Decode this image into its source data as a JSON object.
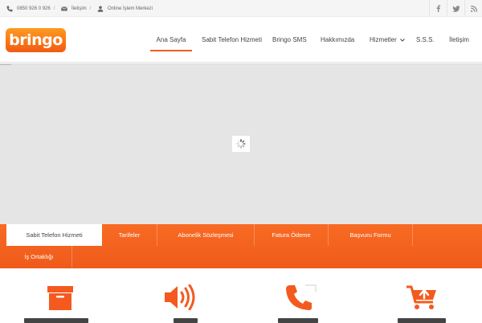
{
  "colors": {
    "accent": "#f45a1e",
    "topbar_bg": "#f5f5f5",
    "slider_bg": "#e5e5e5"
  },
  "topbar": {
    "phone": {
      "icon": "phone-icon",
      "text": "0850 926 0 926"
    },
    "contact": {
      "icon": "envelope-icon",
      "text": "İletişim"
    },
    "online_center": {
      "icon": "user-icon",
      "text": "Online İşlem Merkezi"
    },
    "separator": "/",
    "social": [
      "facebook-icon",
      "twitter-icon",
      "rss-icon"
    ]
  },
  "header": {
    "logo_text": "bringo",
    "nav": [
      {
        "label": "Ana Sayfa",
        "active": true
      },
      {
        "label": "Sabit Telefon Hizmeti"
      },
      {
        "label": "Bringo SMS"
      },
      {
        "label": "Hakkımızda"
      },
      {
        "label": "Hizmetler",
        "has_dropdown": true
      },
      {
        "label": "S.S.S."
      },
      {
        "label": "İletişim"
      }
    ]
  },
  "slider": {
    "loader_icon": "spinner-icon"
  },
  "tabs": [
    {
      "label": "Sabit Telefon Hizmeti",
      "active": true
    },
    {
      "label": "Tarifeler"
    },
    {
      "label": "Abonelik Sözleşmesi"
    },
    {
      "label": "Fatura Ödeme"
    },
    {
      "label": "Başvuru Formu"
    },
    {
      "label": "İş Ortaklığı"
    }
  ],
  "features": [
    {
      "icon": "box-icon"
    },
    {
      "icon": "speaker-icon"
    },
    {
      "icon": "phone-icon"
    },
    {
      "icon": "cart-upload-icon"
    }
  ]
}
